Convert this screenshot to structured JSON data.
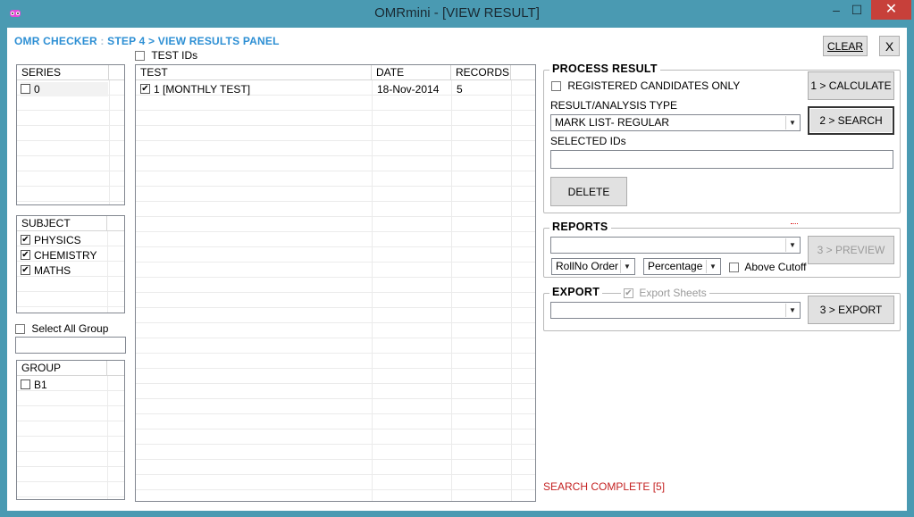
{
  "window": {
    "title": "OMRmini - [VIEW RESULT]",
    "min_glyph": "–",
    "max_glyph": "☐",
    "close_glyph": "✕"
  },
  "breadcrumb": {
    "app": "OMR CHECKER",
    "separator": ":",
    "step": "STEP 4 > VIEW RESULTS PANEL"
  },
  "header_buttons": {
    "clear": "CLEAR",
    "close": "X"
  },
  "series": {
    "header": "SERIES",
    "items": [
      {
        "label": "0",
        "checked": false
      }
    ]
  },
  "subject": {
    "header": "SUBJECT",
    "items": [
      {
        "label": "PHYSICS",
        "checked": true
      },
      {
        "label": "CHEMISTRY",
        "checked": true
      },
      {
        "label": "MATHS",
        "checked": true
      }
    ]
  },
  "select_all_group": {
    "label": "Select All Group",
    "checked": false,
    "input_value": ""
  },
  "group": {
    "header": "GROUP",
    "items": [
      {
        "label": "B1",
        "checked": false
      }
    ]
  },
  "test_ids": {
    "label": "TEST IDs",
    "checked": false
  },
  "tests_table": {
    "columns": [
      "TEST",
      "DATE",
      "RECORDS"
    ],
    "rows": [
      {
        "test": "1 [MONTHLY TEST]",
        "date": "18-Nov-2014",
        "records": "5",
        "checked": true
      }
    ]
  },
  "process_result": {
    "title": "PROCESS RESULT",
    "registered_only_label": "REGISTERED CANDIDATES ONLY",
    "registered_only_checked": false,
    "calculate_label": "1 > CALCULATE",
    "analysis_type_label": "RESULT/ANALYSIS TYPE",
    "analysis_type_value": "MARK LIST- REGULAR",
    "search_label": "2 > SEARCH",
    "selected_ids_label": "SELECTED IDs",
    "selected_ids_value": "",
    "delete_label": "DELETE"
  },
  "reports": {
    "title": "REPORTS",
    "report_value": "",
    "order_value": "RollNo Order",
    "mode_value": "Percentage",
    "above_cutoff_label": "Above Cutoff",
    "above_cutoff_checked": false,
    "preview_label": "3 > PREVIEW"
  },
  "export": {
    "title": "EXPORT",
    "export_sheets_label": "Export Sheets",
    "export_sheets_checked": true,
    "export_value": "",
    "export_label": "3 > EXPORT"
  },
  "status": {
    "text": "SEARCH COMPLETE [5]"
  },
  "colors": {
    "title_bar": "#4a9ab2",
    "heading_blue": "#2d8fd4",
    "status_red": "#c42222",
    "close_red": "#c7403a"
  }
}
